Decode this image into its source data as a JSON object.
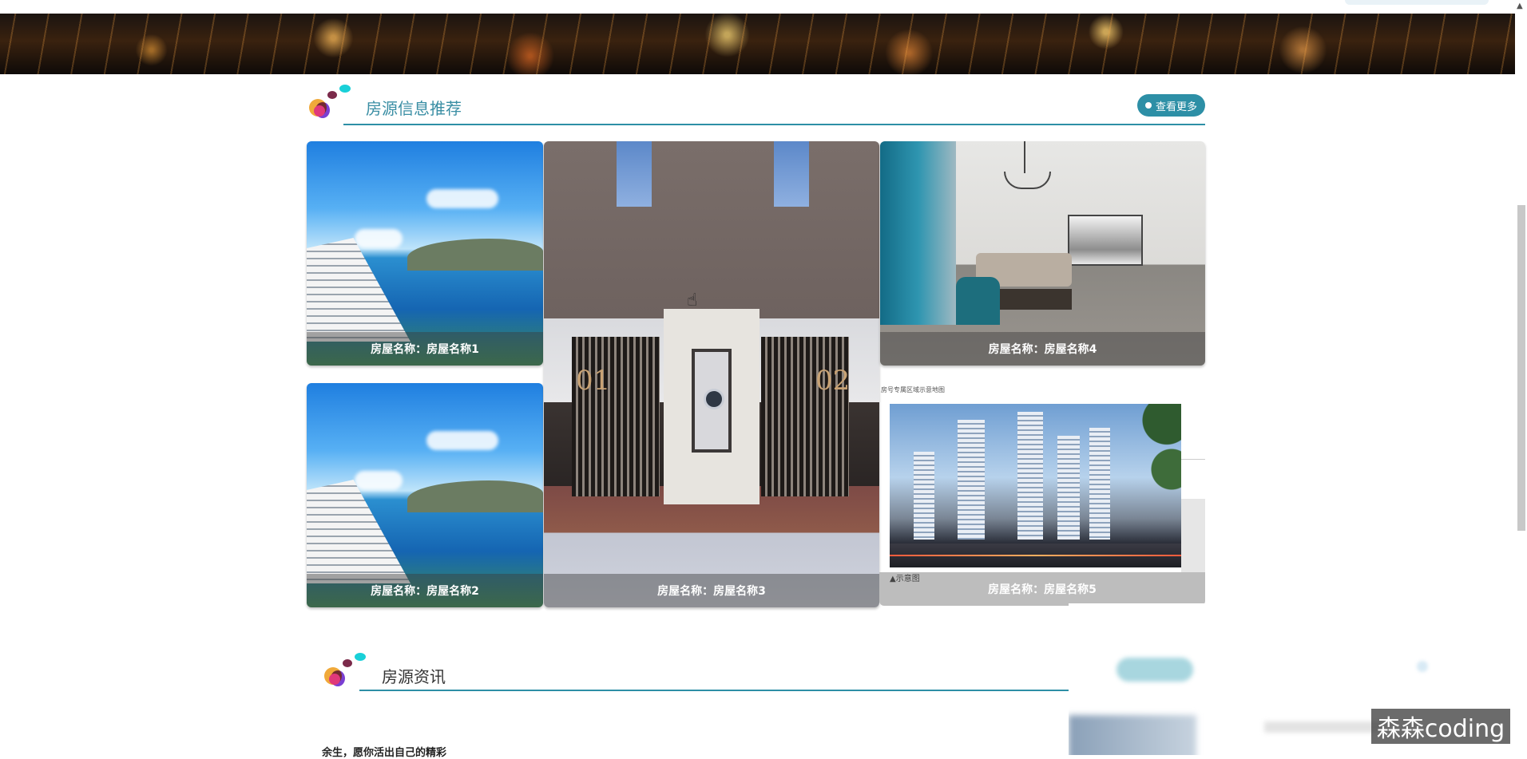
{
  "section_house": {
    "title": "房源信息推荐",
    "more_label": "查看更多",
    "cards": [
      {
        "caption": "房屋名称：房屋名称1",
        "image": "seaside-hotel-photo"
      },
      {
        "caption": "房屋名称：房屋名称2",
        "image": "seaside-hotel-photo"
      },
      {
        "caption": "房屋名称：房屋名称3",
        "image": "building-entrance-photo"
      },
      {
        "caption": "房屋名称：房屋名称4",
        "image": "living-room-photo"
      },
      {
        "caption": "房屋名称：房屋名称5",
        "image": "apartment-towers-photo"
      }
    ],
    "embedded_note": "房号专属区域示意地图",
    "embedded_caption": "▲示意图"
  },
  "section_news": {
    "title": "房源资讯",
    "first_item": "余生，愿你活出自己的精彩"
  },
  "watermark": "森森coding",
  "colors": {
    "accent": "#2d8fa6"
  }
}
